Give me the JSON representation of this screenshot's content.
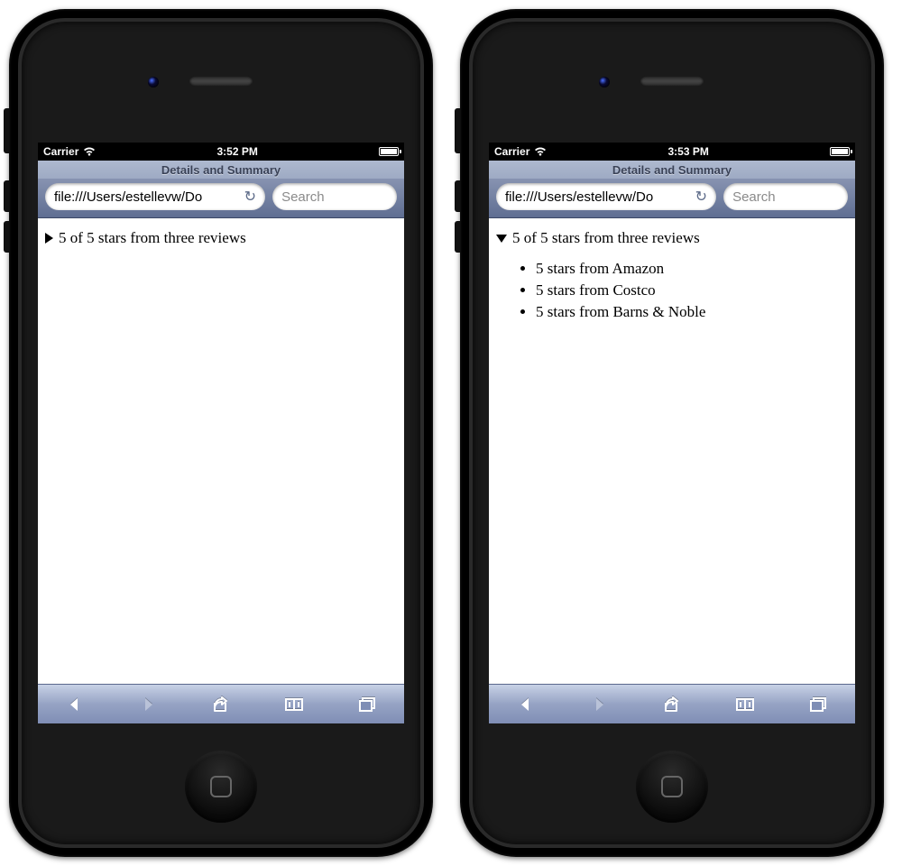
{
  "phones": [
    {
      "status": {
        "carrier": "Carrier",
        "time": "3:52 PM"
      },
      "browser": {
        "page_title": "Details and Summary",
        "url": "file:///Users/estellevw/Do",
        "search_placeholder": "Search"
      },
      "content": {
        "summary": "5 of 5 stars from three reviews",
        "expanded": false,
        "items": []
      }
    },
    {
      "status": {
        "carrier": "Carrier",
        "time": "3:53 PM"
      },
      "browser": {
        "page_title": "Details and Summary",
        "url": "file:///Users/estellevw/Do",
        "search_placeholder": "Search"
      },
      "content": {
        "summary": "5 of 5 stars from three reviews",
        "expanded": true,
        "items": [
          "5 stars from Amazon",
          "5 stars from Costco",
          "5 stars from Barns & Noble"
        ]
      }
    }
  ]
}
